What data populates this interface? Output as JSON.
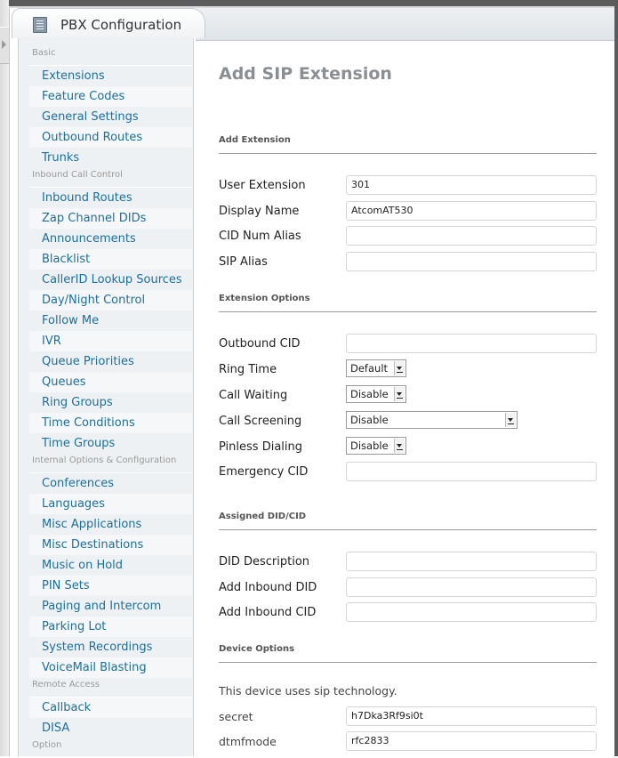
{
  "tab": {
    "label": "PBX Configuration",
    "icon": "document-icon"
  },
  "sidebar": {
    "sections": [
      {
        "title": "Basic",
        "items": [
          "Extensions",
          "Feature Codes",
          "General Settings",
          "Outbound Routes",
          "Trunks"
        ]
      },
      {
        "title": "Inbound Call Control",
        "items": [
          "Inbound Routes",
          "Zap Channel DIDs",
          "Announcements",
          "Blacklist",
          "CallerID Lookup Sources",
          "Day/Night Control",
          "Follow Me",
          "IVR",
          "Queue Priorities",
          "Queues",
          "Ring Groups",
          "Time Conditions",
          "Time Groups"
        ]
      },
      {
        "title": "Internal Options & Configuration",
        "items": [
          "Conferences",
          "Languages",
          "Misc Applications",
          "Misc Destinations",
          "Music on Hold",
          "PIN Sets",
          "Paging and Intercom",
          "Parking Lot",
          "System Recordings",
          "VoiceMail Blasting"
        ]
      },
      {
        "title": "Remote Access",
        "items": [
          "Callback",
          "DISA"
        ]
      },
      {
        "title": "Option",
        "items": []
      }
    ]
  },
  "main": {
    "title": "Add SIP Extension",
    "sections": {
      "add_extension": "Add Extension",
      "extension_options": "Extension Options",
      "assigned_did": "Assigned DID/CID",
      "device_options": "Device Options"
    },
    "fields": {
      "user_extension": {
        "label": "User Extension",
        "value": "301"
      },
      "display_name": {
        "label": "Display Name",
        "value": "AtcomAT530"
      },
      "cid_num_alias": {
        "label": "CID Num Alias",
        "value": ""
      },
      "sip_alias": {
        "label": "SIP Alias",
        "value": ""
      },
      "outbound_cid": {
        "label": "Outbound CID",
        "value": ""
      },
      "ring_time": {
        "label": "Ring Time",
        "value": "Default"
      },
      "call_waiting": {
        "label": "Call Waiting",
        "value": "Disable"
      },
      "call_screening": {
        "label": "Call Screening",
        "value": "Disable"
      },
      "pinless_dialing": {
        "label": "Pinless Dialing",
        "value": "Disable"
      },
      "emergency_cid": {
        "label": "Emergency CID",
        "value": ""
      },
      "did_description": {
        "label": "DID Description",
        "value": ""
      },
      "add_inbound_did": {
        "label": "Add Inbound DID",
        "value": ""
      },
      "add_inbound_cid": {
        "label": "Add Inbound CID",
        "value": ""
      },
      "secret": {
        "label": "secret",
        "value": "h7Dka3Rf9si0t"
      },
      "dtmfmode": {
        "label": "dtmfmode",
        "value": "rfc2833"
      }
    },
    "device_note": "This device uses sip technology."
  },
  "colors": {
    "link": "#1b6f9f",
    "title": "#8a8f93",
    "sidebar_bg": "#eef1f4"
  }
}
